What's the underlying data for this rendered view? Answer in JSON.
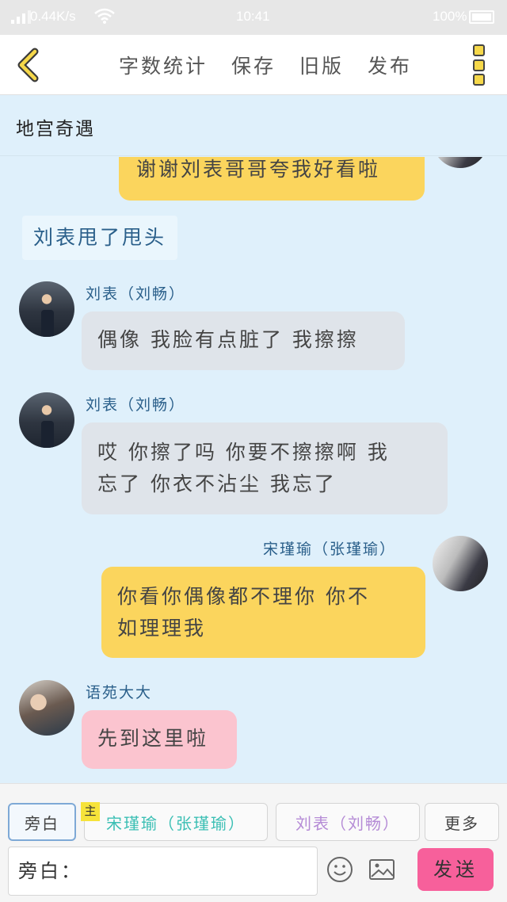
{
  "status_bar": {
    "network_speed": "0.44K/s",
    "time": "10:41",
    "battery_percent": "100%"
  },
  "toolbar": {
    "back_icon": "chevron-left-icon",
    "actions": [
      "字数统计",
      "保存",
      "旧版",
      "发布"
    ],
    "menu_icon": "more-vertical-icon"
  },
  "story": {
    "title": "地宫奇遇"
  },
  "messages": [
    {
      "type": "right",
      "color": "yellow",
      "text": "谢谢刘表哥哥夸我好看啦"
    },
    {
      "type": "narration",
      "text": "刘表甩了甩头"
    },
    {
      "type": "left",
      "name": "刘表（刘畅）",
      "color": "gray",
      "text": "偶像 我脸有点脏了 我擦擦"
    },
    {
      "type": "left",
      "name": "刘表（刘畅）",
      "color": "gray",
      "text_line1": "哎 你擦了吗 你要不擦擦啊 我",
      "text_line2": "忘了 你衣不沾尘 我忘了"
    },
    {
      "type": "right",
      "name": "宋瑾瑜（张瑾瑜）",
      "color": "yellow",
      "text_line1": "你看你偶像都不理你 你不",
      "text_line2": "如理理我"
    },
    {
      "type": "left",
      "name": "语苑大大",
      "color": "pink",
      "text": "先到这里啦"
    }
  ],
  "characters": {
    "narrator": "旁白",
    "main_tag": "主",
    "song": "宋瑾瑜（张瑾瑜）",
    "liu": "刘表（刘畅）",
    "more": "更多"
  },
  "composer": {
    "input_value": "旁白：",
    "emoji_icon": "emoji-icon",
    "image_icon": "image-icon",
    "send_label": "发送"
  },
  "colors": {
    "background": "#dff0fb",
    "bubble_yellow": "#fbd55d",
    "bubble_gray": "#dfe4ea",
    "bubble_pink": "#fbc4cf",
    "send_button": "#f7609b",
    "name_text": "#2a5f8a"
  }
}
